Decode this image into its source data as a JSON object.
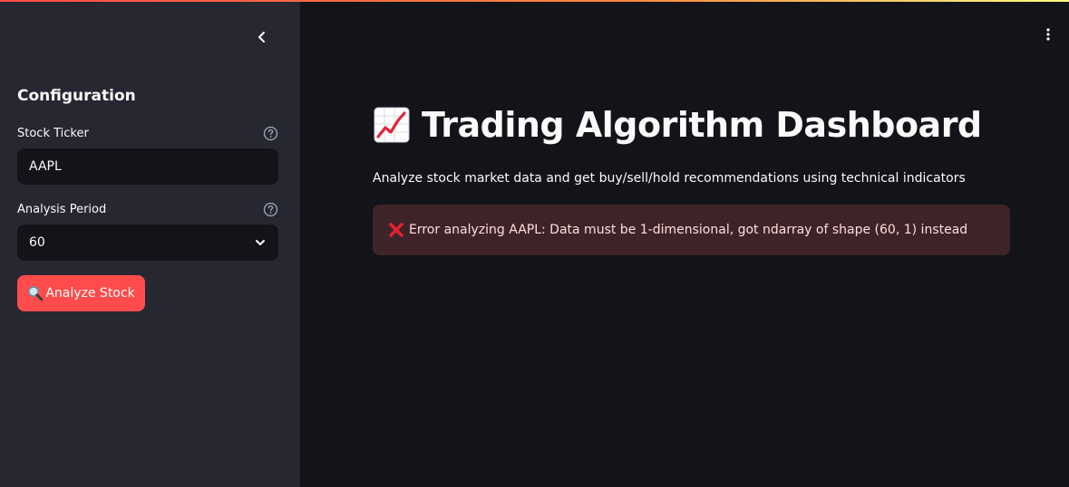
{
  "sidebar": {
    "title": "Configuration",
    "ticker": {
      "label": "Stock Ticker",
      "value": "AAPL"
    },
    "period": {
      "label": "Analysis Period",
      "value": "60"
    },
    "analyze_button": "Analyze Stock"
  },
  "main": {
    "title": "Trading Algorithm Dashboard",
    "subtitle": "Analyze stock market data and get buy/sell/hold recommendations using technical indicators",
    "error": "Error analyzing AAPL: Data must be 1-dimensional, got ndarray of shape (60, 1) instead"
  },
  "icons": {
    "collapse": "chevron-left-icon",
    "help": "question-circle-icon",
    "dropdown": "chevron-down-icon",
    "magnifier": "magnifying-glass-icon",
    "chart": "chart-increasing-icon",
    "error": "cross-mark-icon",
    "menu": "vertical-dots-icon"
  },
  "colors": {
    "accent": "#ff4b4b",
    "sidebar_bg": "#262730",
    "main_bg": "#131419",
    "error_bg": "#3e2428"
  }
}
